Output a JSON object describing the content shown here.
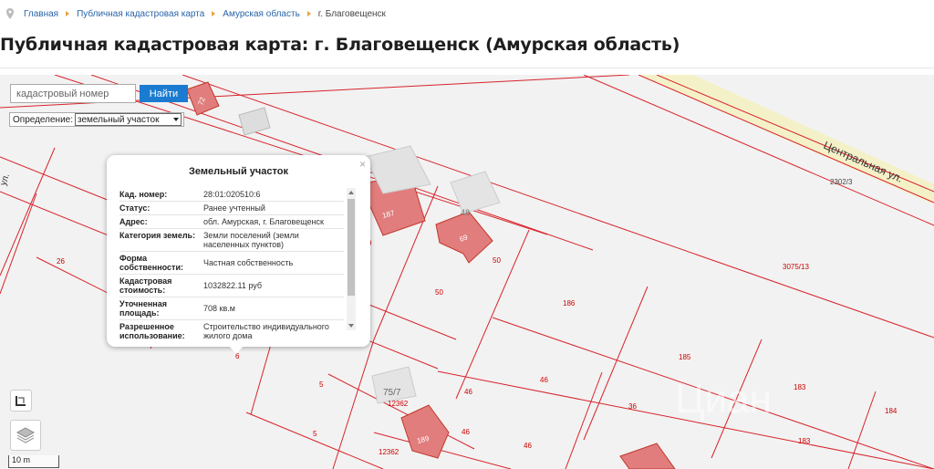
{
  "breadcrumb": {
    "items": [
      "Главная",
      "Публичная кадастровая карта",
      "Амурская область"
    ],
    "current": "г. Благовещенск"
  },
  "page_title": "Публичная кадастровая карта: г. Благовещенск (Амурская область)",
  "map": {
    "search_placeholder": "кадастровый номер",
    "search_button": "Найти",
    "definition_label": "Определение:",
    "definition_value": "земельный участок",
    "scale_label": "10 m",
    "street_labels": [
      "Центральная ул.",
      "ул."
    ],
    "parcel_labels": [
      "26",
      "50",
      "50",
      "186",
      "185",
      "3075/13",
      "183",
      "184",
      "2302/3",
      "46",
      "46",
      "46",
      "46",
      "36",
      "183",
      "5",
      "5",
      "12362",
      "12362",
      "75/7",
      "6",
      "9"
    ],
    "building_labels": [
      "187",
      "69",
      "189",
      "48",
      "72"
    ],
    "accent_color": "#1b7bd0",
    "parcel_line_color": "#d8232a",
    "building_color": "#e27d7d"
  },
  "popup": {
    "title": "Земельный участок",
    "close": "×",
    "rows": [
      {
        "key": "Кад. номер:",
        "value": "28:01:020510:6"
      },
      {
        "key": "Статус:",
        "value": "Ранее учтенный"
      },
      {
        "key": "Адрес:",
        "value": "обл. Амурская, г. Благовещенск"
      },
      {
        "key": "Категория земель:",
        "value": "Земли поселений (земли населенных пунктов)"
      },
      {
        "key": "Форма собственности:",
        "value": "Частная собственность"
      },
      {
        "key": "Кадастровая стоимость:",
        "value": "1032822.11 руб"
      },
      {
        "key": "Уточненная площадь:",
        "value": "708 кв.м"
      },
      {
        "key": "Разрешенное использование:",
        "value": "Строительство индивидуального жилого дома"
      }
    ]
  }
}
